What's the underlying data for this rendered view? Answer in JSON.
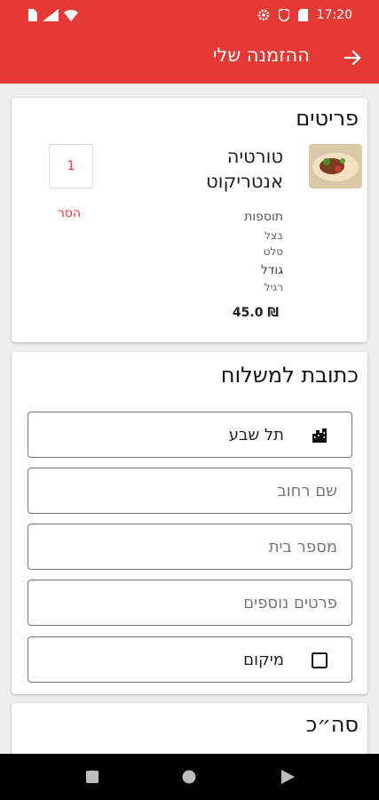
{
  "status": {
    "time": "17:20"
  },
  "header": {
    "title": "ההזמנה שלי"
  },
  "items_section": {
    "title": "פריטים",
    "item": {
      "name": "טורטיה אנטריקוט",
      "additions_label": "תוספות",
      "additions": [
        "בצל",
        "סלט"
      ],
      "size_label": "גודל",
      "size_value": "רגיל",
      "price": "45.0 ₪",
      "quantity": "1",
      "remove_label": "הסר"
    }
  },
  "address_section": {
    "title": "כתובת למשלוח",
    "city_value": "תל שבע",
    "street_placeholder": "שם רחוב",
    "house_placeholder": "מספר בית",
    "details_placeholder": "פרטים נוספים",
    "location_label": "מיקום"
  },
  "total_section": {
    "title": "סה״כ"
  },
  "colors": {
    "accent": "#e53935"
  }
}
